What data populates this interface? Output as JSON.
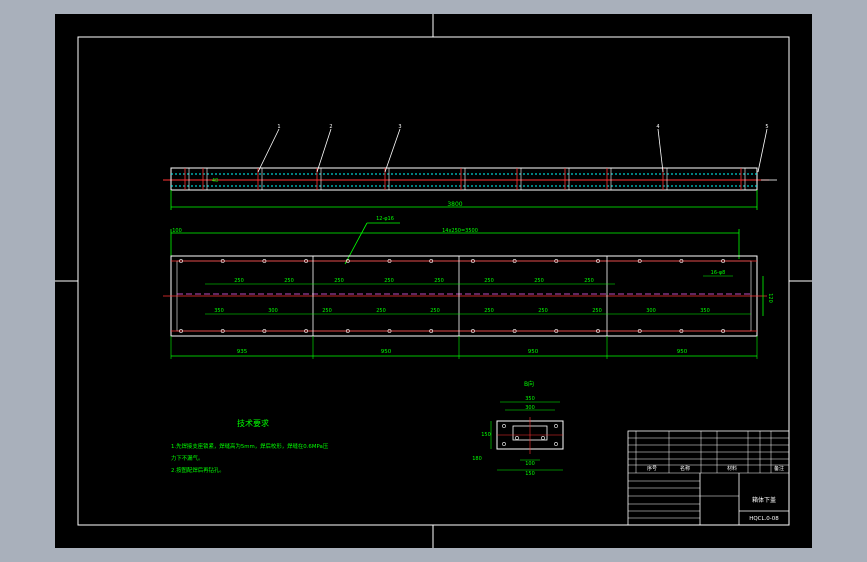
{
  "drawing": {
    "part_numbers": [
      "1",
      "2",
      "3",
      "4",
      "5"
    ],
    "side_view": {
      "overall_length": "3800",
      "left_tag": "40"
    },
    "top_view": {
      "hole_note": "12-φ16",
      "hole_pitch": "14x250=3500",
      "left_offset": "100",
      "upper_row": [
        "250",
        "250",
        "250",
        "250",
        "250",
        "250",
        "250",
        "250"
      ],
      "lower_row": [
        "350",
        "300",
        "250",
        "250",
        "250",
        "250",
        "250",
        "250",
        "300",
        "350"
      ],
      "side_hole_note": "16-φ8",
      "width": "120",
      "segments": [
        "935",
        "950",
        "950",
        "950"
      ]
    },
    "section": {
      "label": "B向",
      "dims": [
        "350",
        "300",
        "150",
        "100",
        "150",
        "180"
      ]
    },
    "tech_requirements": {
      "title": "技术要求",
      "items": [
        "1.先焊接支座锁紧，焊缝高为5mm，焊后校形，焊缝在0.6MPa压",
        "力下不漏气。",
        "2.按图配焊后再钻孔。"
      ]
    },
    "title_block": {
      "drawing_name": "箱体下盖",
      "drawing_number": "HQCL.0-08",
      "header": {
        "no": "序号",
        "name": "名称",
        "material": "材料",
        "remark": "备注"
      }
    }
  }
}
